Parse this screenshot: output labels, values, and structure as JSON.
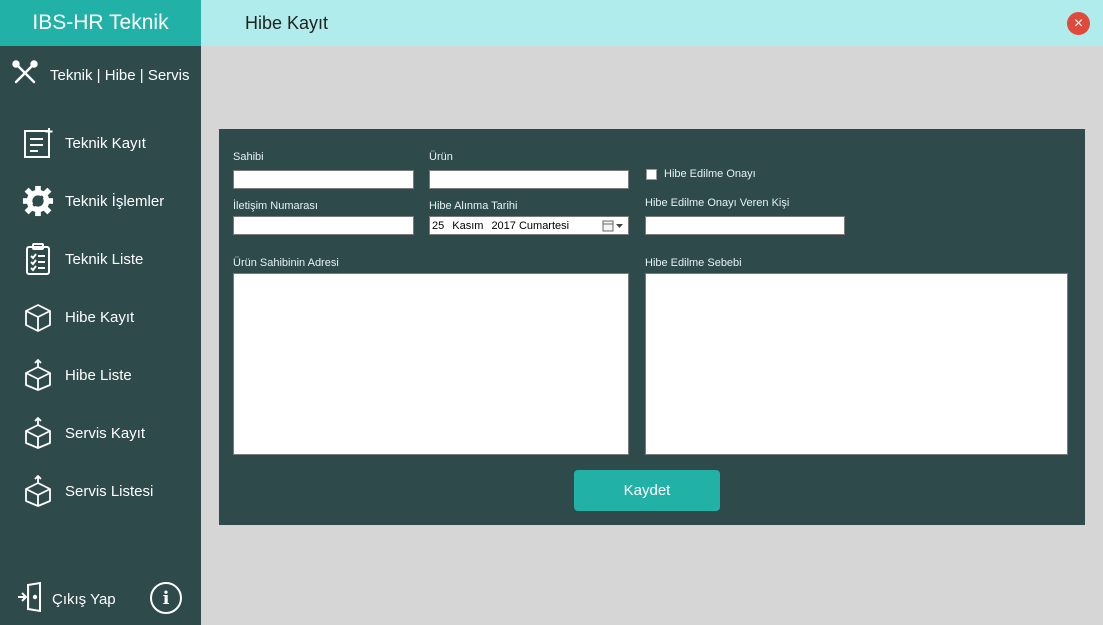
{
  "app": {
    "brand": "IBS-HR Teknik",
    "module": "Teknik | Hibe | Servis"
  },
  "nav": [
    {
      "label": "Teknik Kayıt",
      "icon": "document-edit-icon"
    },
    {
      "label": "Teknik İşlemler",
      "icon": "gear-wrench-icon"
    },
    {
      "label": "Teknik Liste",
      "icon": "clipboard-list-icon"
    },
    {
      "label": "Hibe Kayıt",
      "icon": "box-icon"
    },
    {
      "label": "Hibe Liste",
      "icon": "box-icon"
    },
    {
      "label": "Servis Kayıt",
      "icon": "box-icon"
    },
    {
      "label": "Servis Listesi",
      "icon": "box-icon"
    }
  ],
  "footer": {
    "logout_label": "Çıkış Yap",
    "info_label": "i"
  },
  "page": {
    "title": "Hibe Kayıt",
    "close_symbol": "×"
  },
  "form": {
    "sahibi_label": "Sahibi",
    "urun_label": "Ürün",
    "iletisim_label": "İletişim Numarası",
    "tarih_label": "Hibe Alınma Tarihi",
    "tarih_day": "25",
    "tarih_month": "Kasım",
    "tarih_rest": "2017 Cumartesi",
    "onay_label": "Hibe Edilme Onayı",
    "onay_checked": false,
    "onay_veren_label": "Hibe Edilme Onayı Veren Kişi",
    "adres_label": "Ürün Sahibinin Adresi",
    "sebep_label": "Hibe Edilme Sebebi",
    "save_label": "Kaydet"
  },
  "colors": {
    "accent": "#21b1a6",
    "sidebar": "#2e4a4b",
    "topbar": "#b1ecec",
    "close": "#e04a3c",
    "background": "#d6d6d6"
  }
}
